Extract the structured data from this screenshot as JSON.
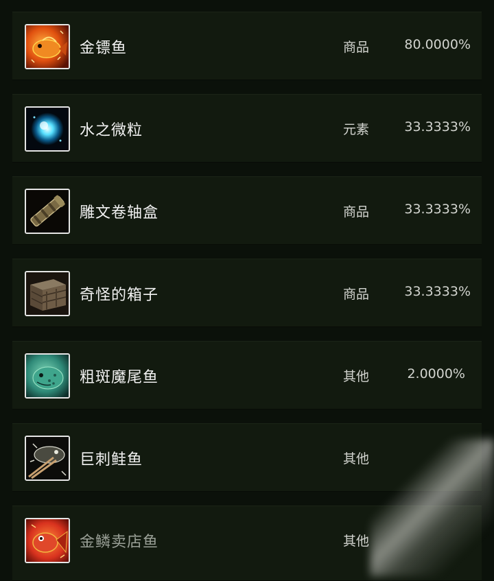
{
  "items": [
    {
      "name": "金镖鱼",
      "category": "商品",
      "rate": "80.0000%",
      "icon": "golden-darter-fish-icon",
      "colors": {
        "bg1": "#f07a1c",
        "bg2": "#7a1c06",
        "accent": "#ffd24a"
      }
    },
    {
      "name": "水之微粒",
      "category": "元素",
      "rate": "33.3333%",
      "icon": "mote-of-water-icon",
      "colors": {
        "bg1": "#0a1a2a",
        "bg2": "#02060c",
        "accent": "#58e0ff"
      }
    },
    {
      "name": "雕文卷轴盒",
      "category": "商品",
      "rate": "33.3333%",
      "icon": "scroll-case-icon",
      "colors": {
        "bg1": "#2a2418",
        "bg2": "#0a0805",
        "accent": "#b9a776"
      }
    },
    {
      "name": "奇怪的箱子",
      "category": "商品",
      "rate": "33.3333%",
      "icon": "wooden-crate-icon",
      "colors": {
        "bg1": "#5a4a38",
        "bg2": "#231a12",
        "accent": "#8a7a62"
      }
    },
    {
      "name": "粗斑魔尾鱼",
      "category": "其他",
      "rate": "2.0000%",
      "icon": "spotted-fish-icon",
      "colors": {
        "bg1": "#2f8a78",
        "bg2": "#0d2e2a",
        "accent": "#9fe6c8"
      }
    },
    {
      "name": "巨刺鲑鱼",
      "category": "其他",
      "rate": "",
      "icon": "spiny-salmon-icon",
      "colors": {
        "bg1": "#3a3a32",
        "bg2": "#0c0c0a",
        "accent": "#d8d8cc"
      }
    },
    {
      "name": "金鳞卖店鱼",
      "category": "其他",
      "rate": "",
      "icon": "golden-scale-fish-icon",
      "colors": {
        "bg1": "#d8321e",
        "bg2": "#5a0c06",
        "accent": "#f2b640"
      }
    }
  ]
}
